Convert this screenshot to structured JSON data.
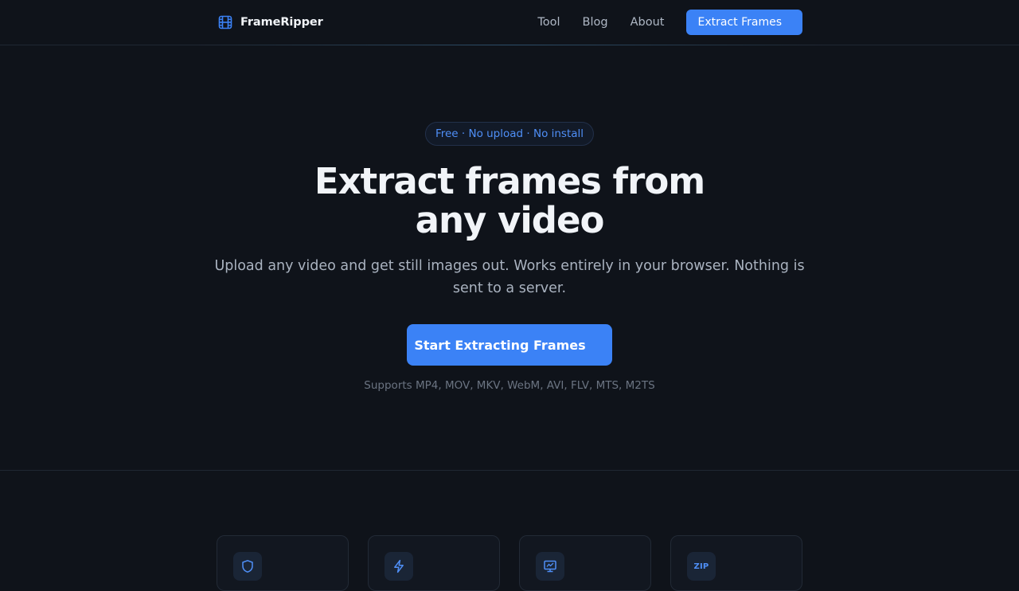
{
  "brand": {
    "name": "FrameRipper",
    "icon": "film-icon",
    "accent": "#3b82f6"
  },
  "nav": {
    "links": [
      {
        "label": "Tool"
      },
      {
        "label": "Blog"
      },
      {
        "label": "About"
      }
    ],
    "cta_label": "Extract Frames"
  },
  "hero": {
    "pill": "Free · No upload · No install",
    "headline_line1": "Extract frames from",
    "headline_line2": "any video",
    "subtext": "Upload any video and get still images out. Works entirely in your browser. Nothing is sent to a server.",
    "cta_label": "Start Extracting Frames",
    "formats": "Supports MP4, MOV, MKV, WebM, AVI, FLV, MTS, M2TS"
  },
  "features": {
    "cards": [
      {
        "icon": "shield-icon"
      },
      {
        "icon": "lightning-icon"
      },
      {
        "icon": "monitor-icon"
      },
      {
        "icon": "zip-icon",
        "icon_text": "ZIP"
      }
    ]
  },
  "colors": {
    "background": "#0f131a",
    "accent": "#3b82f6",
    "pill_text": "#4f8ff7"
  }
}
